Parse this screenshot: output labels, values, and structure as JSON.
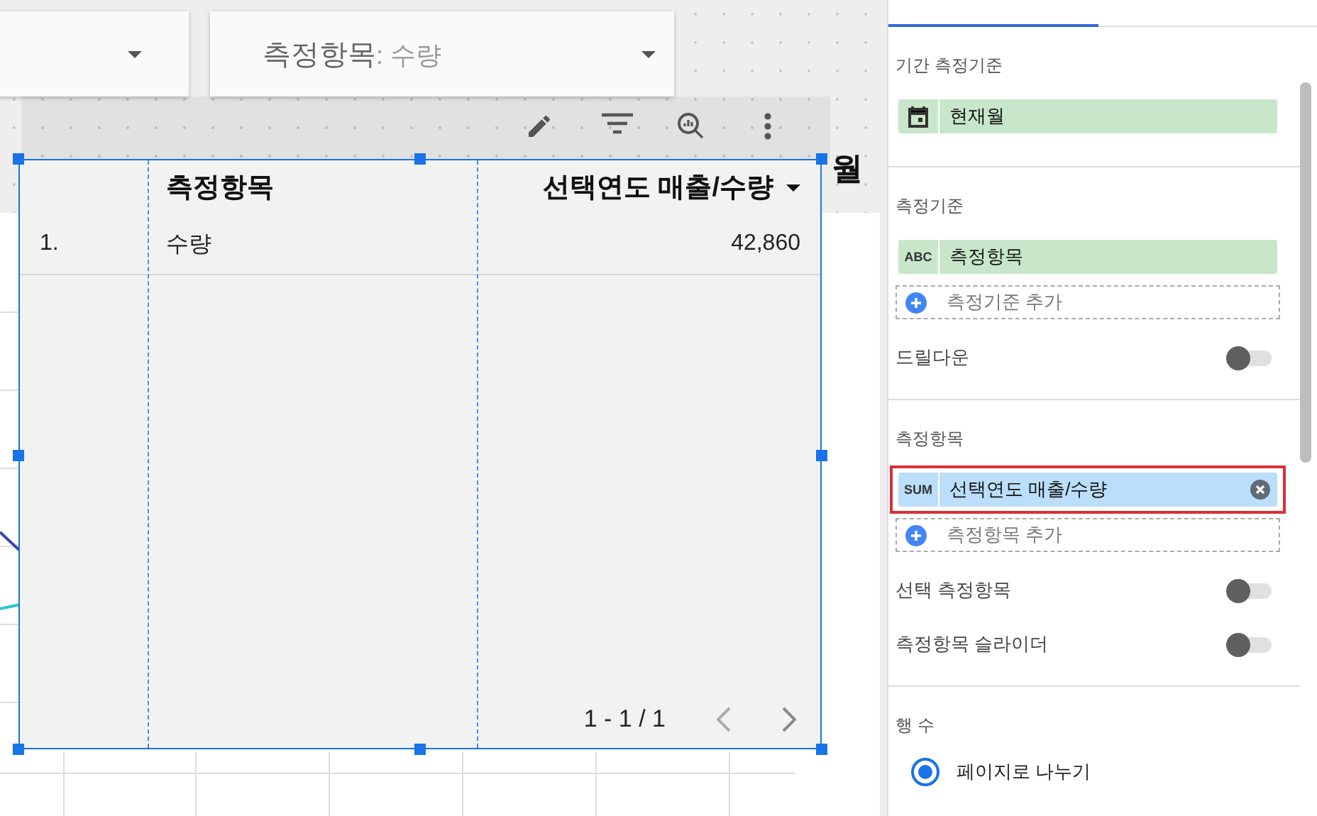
{
  "canvas": {
    "filters": [
      {
        "kind": "blank"
      },
      {
        "kind": "labeled",
        "label": "측정항목",
        "value": ": 수량"
      }
    ],
    "side_title": "월",
    "table": {
      "columns": [
        {
          "kind": "index"
        },
        {
          "kind": "field",
          "label": "측정항목",
          "sorted": false
        },
        {
          "kind": "field",
          "label": "선택연도 매출/수량",
          "sorted": true
        }
      ],
      "rows": [
        [
          "1.",
          "수량",
          "42,860"
        ]
      ],
      "pagination": "1 - 1 / 1"
    }
  },
  "panel": {
    "sections": [
      {
        "title": "기간 측정기준",
        "chips": [
          {
            "kind": "date",
            "label": "현재월",
            "removable": false,
            "highlighted": false
          }
        ]
      },
      {
        "title": "측정기준",
        "chips": [
          {
            "kind": "dimension",
            "tag": "ABC",
            "label": "측정항목",
            "removable": false,
            "highlighted": false
          }
        ],
        "add": "측정기준 추가",
        "toggles": [
          {
            "label": "드릴다운",
            "on": false
          }
        ]
      },
      {
        "title": "측정항목",
        "chips": [
          {
            "kind": "metric",
            "tag": "SUM",
            "label": "선택연도 매출/수량",
            "removable": true,
            "highlighted": true
          }
        ],
        "add": "측정항목 추가",
        "toggles": [
          {
            "label": "선택 측정항목",
            "on": false
          },
          {
            "label": "측정항목 슬라이더",
            "on": false
          }
        ]
      }
    ],
    "rows": {
      "title": "행 수",
      "options": [
        {
          "label": "페이지로 나누기",
          "selected": true
        }
      ]
    }
  }
}
